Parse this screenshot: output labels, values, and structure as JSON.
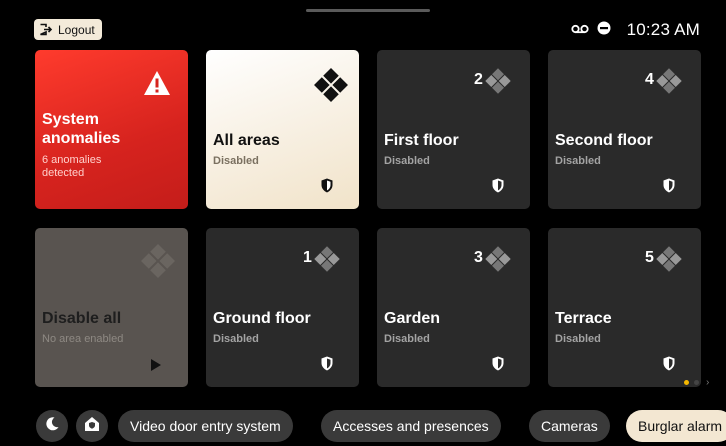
{
  "header": {
    "logout_label": "Logout",
    "time": "10:23 AM"
  },
  "status_icons": [
    "voicemail-icon",
    "do-not-disturb-icon"
  ],
  "tiles": [
    {
      "title": "System\nanomalies",
      "subtitle": "6 anomalies\ndetected",
      "icon": "warning-icon"
    },
    {
      "title": "All areas",
      "subtitle": "Disabled",
      "icon": "diamond-grid-icon",
      "status_icon": "shield-icon"
    },
    {
      "title": "First floor",
      "subtitle": "Disabled",
      "number": "2",
      "icon": "diamond-grid-icon",
      "status_icon": "shield-icon"
    },
    {
      "title": "Second floor",
      "subtitle": "Disabled",
      "number": "4",
      "icon": "diamond-grid-icon",
      "status_icon": "shield-icon"
    },
    {
      "title": "Disable all",
      "subtitle": "No area enabled",
      "icon": "diamond-grid-icon",
      "action_icon": "play-icon"
    },
    {
      "title": "Ground floor",
      "subtitle": "Disabled",
      "number": "1",
      "icon": "diamond-grid-icon",
      "status_icon": "shield-icon"
    },
    {
      "title": "Garden",
      "subtitle": "Disabled",
      "number": "3",
      "icon": "diamond-grid-icon",
      "status_icon": "shield-icon"
    },
    {
      "title": "Terrace",
      "subtitle": "Disabled",
      "number": "5",
      "icon": "diamond-grid-icon",
      "status_icon": "shield-icon"
    }
  ],
  "pagination": {
    "pages": 2,
    "current": 1
  },
  "bottom_nav": {
    "icons": [
      "moon-icon",
      "home-alarm-icon"
    ],
    "pills": [
      "Video door entry system",
      "Accesses and presences",
      "Cameras",
      "Burglar alarm"
    ],
    "active_pill": "Burglar alarm"
  },
  "colors": {
    "background": "#000000",
    "tile": "#2a2a2a",
    "alert": "#ff3b2d",
    "accent_light": "#f3e7d2",
    "page_indicator": "#f5b800"
  }
}
